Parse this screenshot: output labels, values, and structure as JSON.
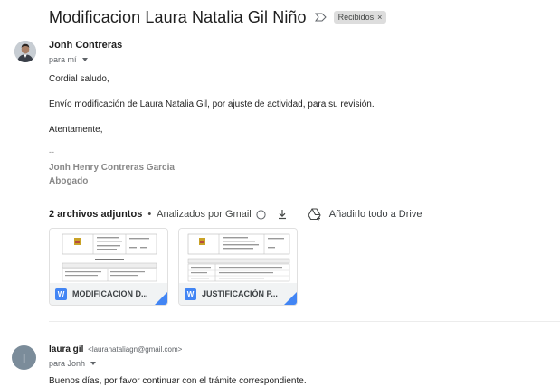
{
  "email": {
    "subject": "Modificacion Laura Natalia Gil Niño",
    "label": "Recibidos",
    "label_close": "×",
    "sender_name": "Jonh Contreras",
    "to_line": "para mí",
    "greeting": "Cordial saludo,",
    "message": "Envío modificación de Laura Natalia Gil, por ajuste de actividad, para su revisión.",
    "closing": "Atentamente,",
    "sig_dashes": "--",
    "sig_name": "Jonh Henry Contreras Garcia",
    "sig_title": "Abogado"
  },
  "attachments": {
    "count_label": "2 archivos adjuntos",
    "separator": "•",
    "scan_label": "Analizados por Gmail",
    "drive_label": "Añadirlo todo a Drive",
    "files": [
      {
        "name": "MODIFICACION D...",
        "type_badge": "W"
      },
      {
        "name": "JUSTIFICACIÓN P...",
        "type_badge": "W"
      }
    ]
  },
  "reply": {
    "avatar_letter": "l",
    "sender_name": "laura gil",
    "sender_email": "<lauranataliagn@gmail.com>",
    "to_line": "para Jonh",
    "message": "Buenos días, por favor continuar con el trámite correspondiente."
  },
  "colors": {
    "word_blue": "#4285f4",
    "avatar_gray": "#7b8c9a",
    "chip_bg": "#dddddd"
  },
  "icons": [
    "important-icon",
    "info-icon",
    "download-icon",
    "drive-add-icon",
    "word-icon",
    "chevron-down-icon"
  ]
}
